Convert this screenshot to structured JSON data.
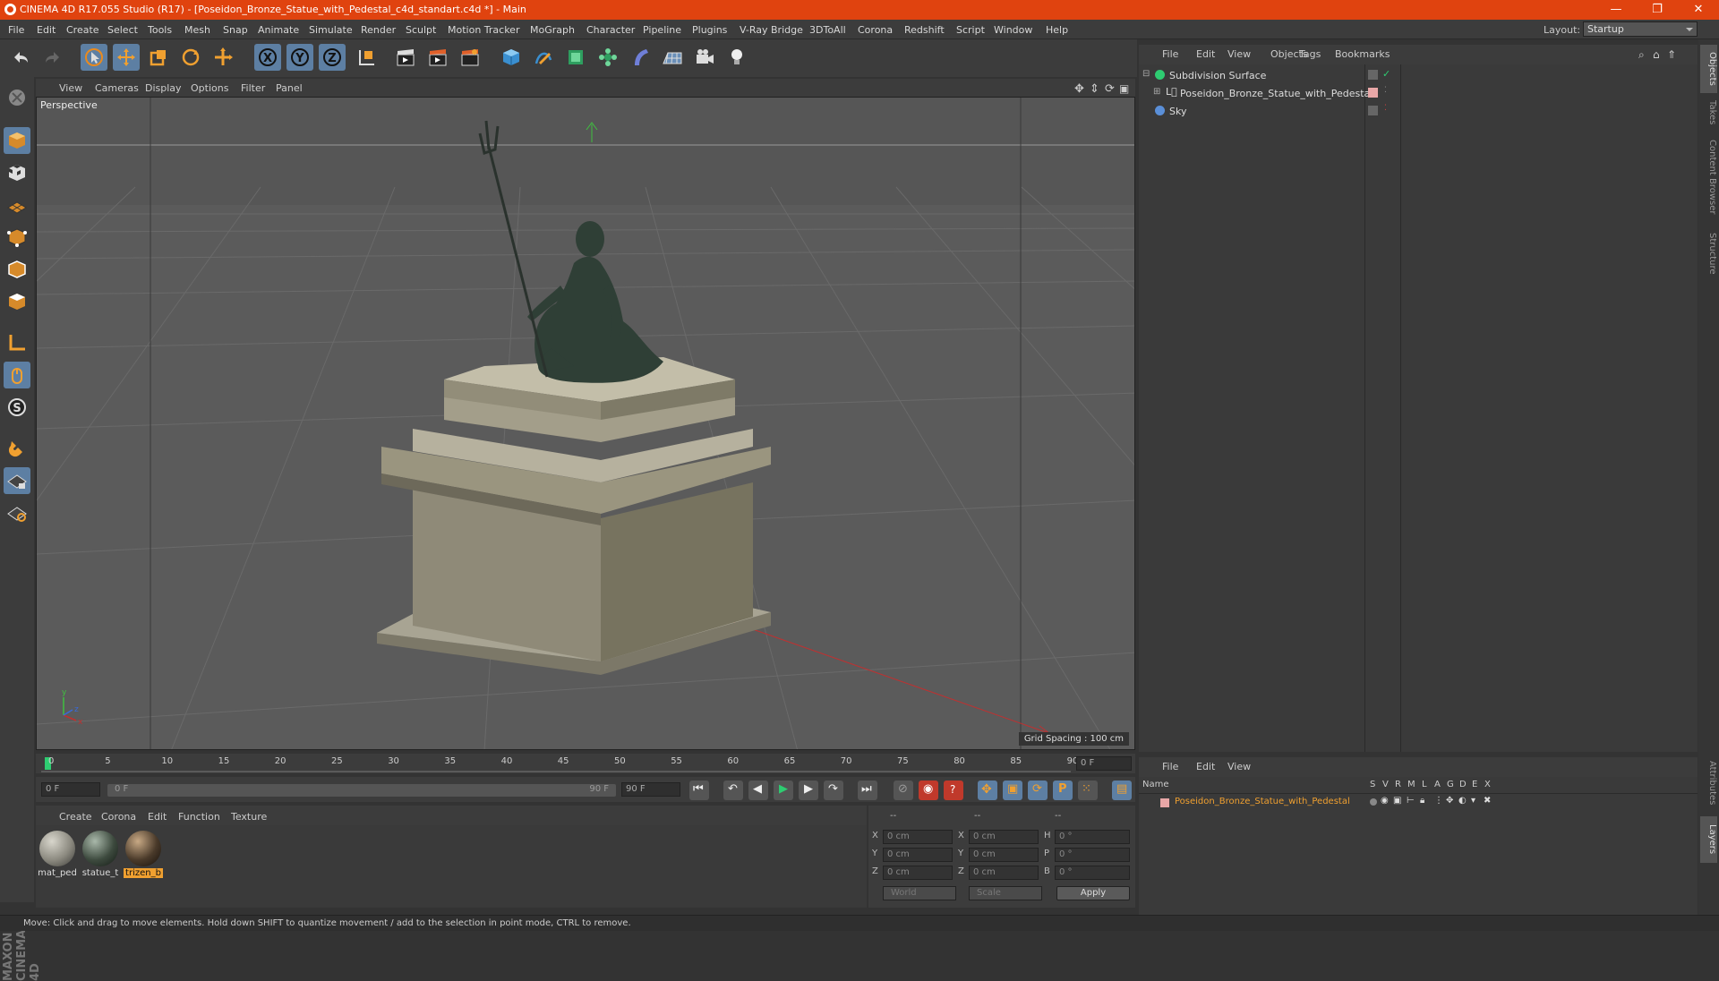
{
  "title_bar": {
    "title": "CINEMA 4D R17.055 Studio (R17) - [Poseidon_Bronze_Statue_with_Pedestal_c4d_standart.c4d *] - Main",
    "minimize": "—",
    "maximize": "❐",
    "close": "✕"
  },
  "menu": {
    "items": [
      "File",
      "Edit",
      "Create",
      "Select",
      "Tools",
      "Mesh",
      "Snap",
      "Animate",
      "Simulate",
      "Render",
      "Sculpt",
      "Motion Tracker",
      "MoGraph",
      "Character",
      "Pipeline",
      "Plugins",
      "V-Ray Bridge",
      "3DToAll",
      "Corona",
      "Redshift",
      "Script",
      "Window",
      "Help"
    ],
    "layout_label": "Layout:",
    "layout_value": "Startup"
  },
  "toolbar": {
    "x_label": "X",
    "y_label": "Y",
    "z_label": "Z"
  },
  "viewport": {
    "menu": [
      "View",
      "Cameras",
      "Display",
      "Options",
      "Filter",
      "Panel"
    ],
    "camera_label": "Perspective",
    "grid_spacing": "Grid Spacing : 100 cm"
  },
  "timeline": {
    "ticks": [
      "0",
      "5",
      "10",
      "15",
      "20",
      "25",
      "30",
      "35",
      "40",
      "45",
      "50",
      "55",
      "60",
      "65",
      "70",
      "75",
      "80",
      "85",
      "90"
    ],
    "current_frame": "0 F"
  },
  "transport": {
    "start_field": "0 F",
    "range_start": "0 F",
    "range_end": "90 F",
    "end_field": "90 F"
  },
  "material_manager": {
    "menu": [
      "Create",
      "Corona",
      "Edit",
      "Function",
      "Texture"
    ],
    "materials": [
      {
        "name": "mat_ped",
        "color": "#8c8a80"
      },
      {
        "name": "statue_t",
        "color": "#3d4a3e"
      },
      {
        "name": "trizen_b",
        "color": "#4a3a2a",
        "selected": true
      }
    ]
  },
  "coordinates": {
    "header": [
      "--",
      "--",
      "--"
    ],
    "rows": [
      {
        "a": "X",
        "av": "0 cm",
        "b": "X",
        "bv": "0 cm",
        "c": "H",
        "cv": "0 °"
      },
      {
        "a": "Y",
        "av": "0 cm",
        "b": "Y",
        "bv": "0 cm",
        "c": "P",
        "cv": "0 °"
      },
      {
        "a": "Z",
        "av": "0 cm",
        "b": "Z",
        "bv": "0 cm",
        "c": "B",
        "cv": "0 °"
      }
    ],
    "mode_world": "World",
    "mode_scale": "Scale",
    "apply": "Apply"
  },
  "object_manager": {
    "menu": [
      "File",
      "Edit",
      "View",
      "Objects",
      "Tags",
      "Bookmarks"
    ],
    "objects": [
      {
        "name": "Subdivision Surface",
        "indent": 0
      },
      {
        "name": "Poseidon_Bronze_Statue_with_Pedestal",
        "indent": 1
      },
      {
        "name": "Sky",
        "indent": 0
      }
    ]
  },
  "layer_manager": {
    "menu": [
      "File",
      "Edit",
      "View"
    ],
    "header_name": "Name",
    "header_cols": [
      "S",
      "V",
      "R",
      "M",
      "L",
      "A",
      "G",
      "D",
      "E",
      "X"
    ],
    "layer_name": "Poseidon_Bronze_Statue_with_Pedestal",
    "layer_color": "#e8a7a7"
  },
  "side_tabs": [
    "Objects",
    "Takes",
    "Content Browser",
    "Structure",
    "Attributes",
    "Layers"
  ],
  "status": "Move: Click and drag to move elements. Hold down SHIFT to quantize movement / add to the selection in point mode, CTRL to remove.",
  "colors": {
    "title_bar": "#e0430f",
    "accent": "#5d7fa3",
    "highlight_text": "#f0a030"
  }
}
